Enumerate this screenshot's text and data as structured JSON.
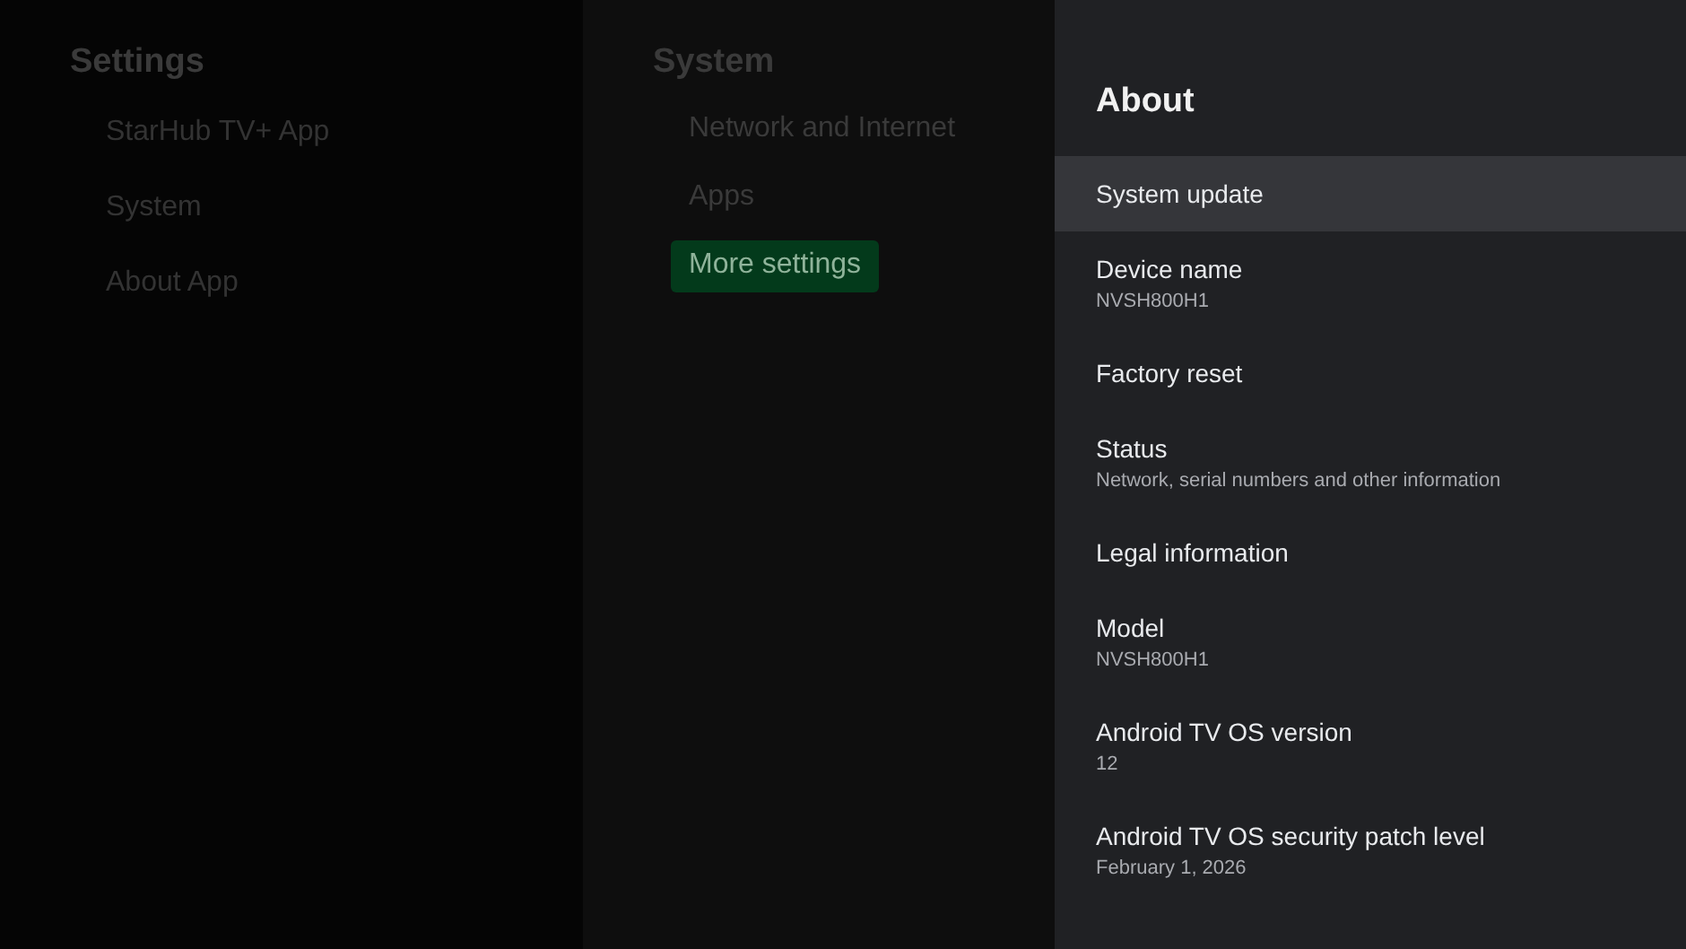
{
  "settings_panel": {
    "title": "Settings",
    "items": [
      {
        "label": "StarHub TV+ App"
      },
      {
        "label": "System"
      },
      {
        "label": "About App"
      }
    ]
  },
  "system_panel": {
    "title": "System",
    "items": [
      {
        "label": "Network and Internet",
        "selected": false
      },
      {
        "label": "Apps",
        "selected": false
      },
      {
        "label": "More settings",
        "selected": true
      }
    ]
  },
  "about_panel": {
    "title": "About",
    "items": [
      {
        "label": "System update",
        "selected": true
      },
      {
        "label": "Device name",
        "summary": "NVSH800H1",
        "selected": false
      },
      {
        "label": "Factory reset",
        "selected": false
      },
      {
        "label": "Status",
        "summary": "Network, serial numbers and other information",
        "selected": false
      },
      {
        "label": "Legal information",
        "selected": false
      },
      {
        "label": "Model",
        "summary": "NVSH800H1",
        "selected": false
      },
      {
        "label": "Android TV OS version",
        "summary": "12",
        "selected": false
      },
      {
        "label": "Android TV OS security patch level",
        "summary": "February 1, 2026",
        "selected": false
      }
    ]
  }
}
